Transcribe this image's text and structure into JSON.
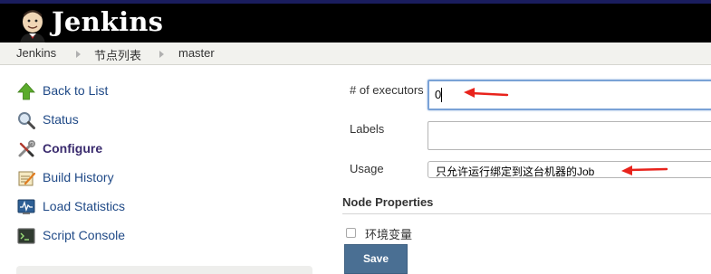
{
  "header": {
    "title": "Jenkins"
  },
  "breadcrumb": {
    "items": [
      "Jenkins",
      "节点列表",
      "master"
    ]
  },
  "sidebar": {
    "items": [
      {
        "label": "Back to List",
        "icon": "up-arrow-icon"
      },
      {
        "label": "Status",
        "icon": "magnifier-icon"
      },
      {
        "label": "Configure",
        "icon": "wrench-screwdriver-icon",
        "current": true
      },
      {
        "label": "Build History",
        "icon": "notepad-icon"
      },
      {
        "label": "Load Statistics",
        "icon": "monitor-graph-icon"
      },
      {
        "label": "Script Console",
        "icon": "terminal-icon"
      }
    ]
  },
  "form": {
    "executors": {
      "label": "# of executors",
      "value": "0"
    },
    "labels": {
      "label": "Labels",
      "value": ""
    },
    "usage": {
      "label": "Usage",
      "value": "只允许运行绑定到这台机器的Job"
    },
    "node_properties": {
      "title": "Node Properties",
      "env_vars_label": "环境变量",
      "env_vars_checked": false
    },
    "save_label": "Save"
  },
  "colors": {
    "header_bg": "#000000",
    "link": "#204a87",
    "save_button": "#4a6f93",
    "annotation_arrow": "#e8231c"
  }
}
